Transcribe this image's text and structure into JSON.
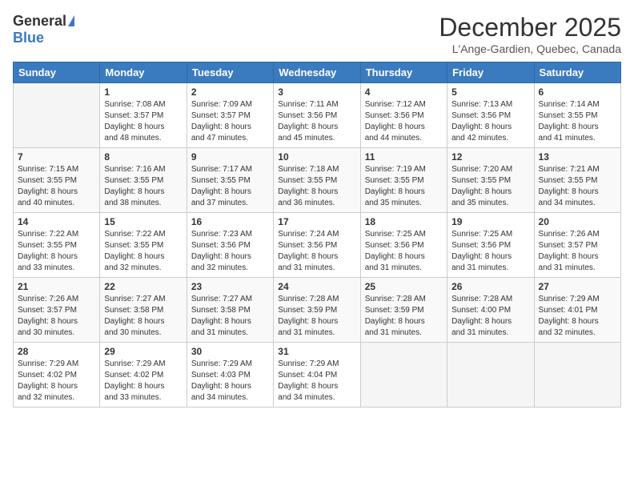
{
  "logo": {
    "general": "General",
    "blue": "Blue"
  },
  "title": "December 2025",
  "location": "L'Ange-Gardien, Quebec, Canada",
  "weekdays": [
    "Sunday",
    "Monday",
    "Tuesday",
    "Wednesday",
    "Thursday",
    "Friday",
    "Saturday"
  ],
  "weeks": [
    [
      {
        "day": "",
        "info": ""
      },
      {
        "day": "1",
        "info": "Sunrise: 7:08 AM\nSunset: 3:57 PM\nDaylight: 8 hours\nand 48 minutes."
      },
      {
        "day": "2",
        "info": "Sunrise: 7:09 AM\nSunset: 3:57 PM\nDaylight: 8 hours\nand 47 minutes."
      },
      {
        "day": "3",
        "info": "Sunrise: 7:11 AM\nSunset: 3:56 PM\nDaylight: 8 hours\nand 45 minutes."
      },
      {
        "day": "4",
        "info": "Sunrise: 7:12 AM\nSunset: 3:56 PM\nDaylight: 8 hours\nand 44 minutes."
      },
      {
        "day": "5",
        "info": "Sunrise: 7:13 AM\nSunset: 3:56 PM\nDaylight: 8 hours\nand 42 minutes."
      },
      {
        "day": "6",
        "info": "Sunrise: 7:14 AM\nSunset: 3:55 PM\nDaylight: 8 hours\nand 41 minutes."
      }
    ],
    [
      {
        "day": "7",
        "info": "Sunrise: 7:15 AM\nSunset: 3:55 PM\nDaylight: 8 hours\nand 40 minutes."
      },
      {
        "day": "8",
        "info": "Sunrise: 7:16 AM\nSunset: 3:55 PM\nDaylight: 8 hours\nand 38 minutes."
      },
      {
        "day": "9",
        "info": "Sunrise: 7:17 AM\nSunset: 3:55 PM\nDaylight: 8 hours\nand 37 minutes."
      },
      {
        "day": "10",
        "info": "Sunrise: 7:18 AM\nSunset: 3:55 PM\nDaylight: 8 hours\nand 36 minutes."
      },
      {
        "day": "11",
        "info": "Sunrise: 7:19 AM\nSunset: 3:55 PM\nDaylight: 8 hours\nand 35 minutes."
      },
      {
        "day": "12",
        "info": "Sunrise: 7:20 AM\nSunset: 3:55 PM\nDaylight: 8 hours\nand 35 minutes."
      },
      {
        "day": "13",
        "info": "Sunrise: 7:21 AM\nSunset: 3:55 PM\nDaylight: 8 hours\nand 34 minutes."
      }
    ],
    [
      {
        "day": "14",
        "info": "Sunrise: 7:22 AM\nSunset: 3:55 PM\nDaylight: 8 hours\nand 33 minutes."
      },
      {
        "day": "15",
        "info": "Sunrise: 7:22 AM\nSunset: 3:55 PM\nDaylight: 8 hours\nand 32 minutes."
      },
      {
        "day": "16",
        "info": "Sunrise: 7:23 AM\nSunset: 3:56 PM\nDaylight: 8 hours\nand 32 minutes."
      },
      {
        "day": "17",
        "info": "Sunrise: 7:24 AM\nSunset: 3:56 PM\nDaylight: 8 hours\nand 31 minutes."
      },
      {
        "day": "18",
        "info": "Sunrise: 7:25 AM\nSunset: 3:56 PM\nDaylight: 8 hours\nand 31 minutes."
      },
      {
        "day": "19",
        "info": "Sunrise: 7:25 AM\nSunset: 3:56 PM\nDaylight: 8 hours\nand 31 minutes."
      },
      {
        "day": "20",
        "info": "Sunrise: 7:26 AM\nSunset: 3:57 PM\nDaylight: 8 hours\nand 31 minutes."
      }
    ],
    [
      {
        "day": "21",
        "info": "Sunrise: 7:26 AM\nSunset: 3:57 PM\nDaylight: 8 hours\nand 30 minutes."
      },
      {
        "day": "22",
        "info": "Sunrise: 7:27 AM\nSunset: 3:58 PM\nDaylight: 8 hours\nand 30 minutes."
      },
      {
        "day": "23",
        "info": "Sunrise: 7:27 AM\nSunset: 3:58 PM\nDaylight: 8 hours\nand 31 minutes."
      },
      {
        "day": "24",
        "info": "Sunrise: 7:28 AM\nSunset: 3:59 PM\nDaylight: 8 hours\nand 31 minutes."
      },
      {
        "day": "25",
        "info": "Sunrise: 7:28 AM\nSunset: 3:59 PM\nDaylight: 8 hours\nand 31 minutes."
      },
      {
        "day": "26",
        "info": "Sunrise: 7:28 AM\nSunset: 4:00 PM\nDaylight: 8 hours\nand 31 minutes."
      },
      {
        "day": "27",
        "info": "Sunrise: 7:29 AM\nSunset: 4:01 PM\nDaylight: 8 hours\nand 32 minutes."
      }
    ],
    [
      {
        "day": "28",
        "info": "Sunrise: 7:29 AM\nSunset: 4:02 PM\nDaylight: 8 hours\nand 32 minutes."
      },
      {
        "day": "29",
        "info": "Sunrise: 7:29 AM\nSunset: 4:02 PM\nDaylight: 8 hours\nand 33 minutes."
      },
      {
        "day": "30",
        "info": "Sunrise: 7:29 AM\nSunset: 4:03 PM\nDaylight: 8 hours\nand 34 minutes."
      },
      {
        "day": "31",
        "info": "Sunrise: 7:29 AM\nSunset: 4:04 PM\nDaylight: 8 hours\nand 34 minutes."
      },
      {
        "day": "",
        "info": ""
      },
      {
        "day": "",
        "info": ""
      },
      {
        "day": "",
        "info": ""
      }
    ]
  ]
}
